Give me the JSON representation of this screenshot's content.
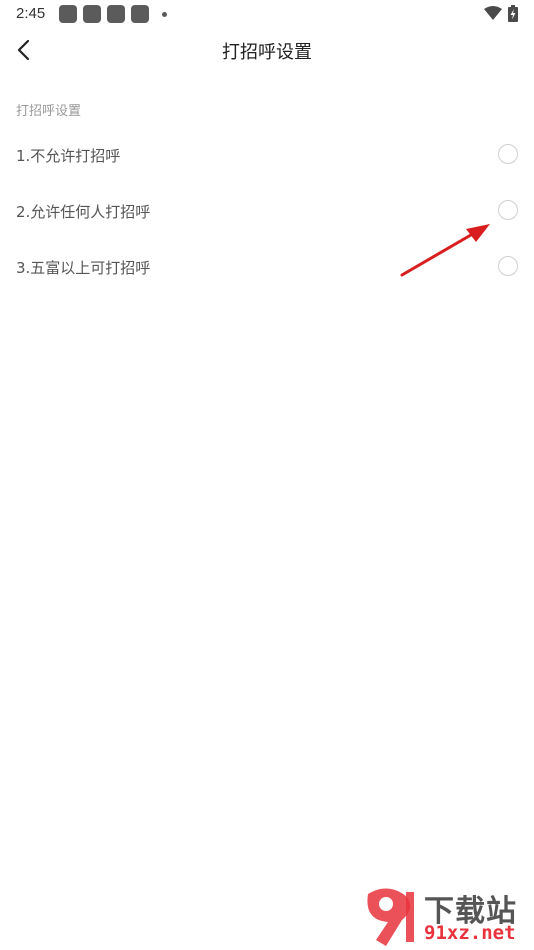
{
  "status_bar": {
    "time": "2:45",
    "notification_icons": [
      "app-icon",
      "app-icon",
      "app-icon",
      "app-icon"
    ],
    "icons": [
      "wifi-icon",
      "battery-charging-icon"
    ]
  },
  "header": {
    "title": "打招呼设置",
    "back_icon": "chevron-left-icon"
  },
  "section": {
    "label": "打招呼设置",
    "options": [
      {
        "label": "1.不允许打招呼",
        "selected": false
      },
      {
        "label": "2.允许任何人打招呼",
        "selected": false
      },
      {
        "label": "3.五富以上可打招呼",
        "selected": false
      }
    ]
  },
  "colors": {
    "annotation_arrow": "#d81e1e",
    "watermark_red": "#e8323c"
  },
  "watermark": {
    "text_top": "下载站",
    "text_bottom": "91xz.net"
  }
}
